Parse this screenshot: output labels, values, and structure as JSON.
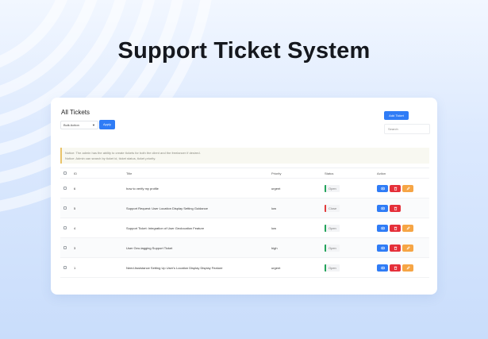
{
  "hero": {
    "title": "Support Ticket System"
  },
  "card": {
    "title": "All Tickets",
    "bulk_action": {
      "selected": "Bulk Action"
    },
    "apply_label": "Apply",
    "add_ticket_label": "Add Ticket",
    "search_placeholder": "Search",
    "notice_lines": [
      "Notice: The admin has the ability to create tickets for both the client and the freelancer if desired.",
      "Notice: Admin can search by ticket id, ticket status, ticket priority."
    ]
  },
  "table": {
    "headers": {
      "id": "ID",
      "title": "Title",
      "priority": "Priority",
      "status": "Status",
      "action": "Action"
    },
    "rows": [
      {
        "id": "6",
        "title": "how to verify my profile",
        "priority": "urgent",
        "status": "Open"
      },
      {
        "id": "5",
        "title": "Support Request: User Location Display Setting Guidance",
        "priority": "low",
        "status": "Close"
      },
      {
        "id": "4",
        "title": "Support Ticket: Integration of User Geolocation Feature",
        "priority": "low",
        "status": "Open"
      },
      {
        "id": "3",
        "title": "User Geo-tagging Support Ticket",
        "priority": "high",
        "status": "Open"
      },
      {
        "id": "1",
        "title": "Need Assistance Setting Up User's Location Display Display Feature",
        "priority": "urgent",
        "status": "Open"
      }
    ]
  },
  "colors": {
    "primary": "#2f7cf6",
    "danger": "#e5303a",
    "warning": "#f6a545",
    "status_open": "#22a35a",
    "status_closed": "#e23a3a",
    "notice_border": "#e9c36a"
  },
  "icons": {
    "view": "eye-icon",
    "delete": "trash-icon",
    "edit": "edit-icon",
    "select": "chevron-down-icon"
  }
}
